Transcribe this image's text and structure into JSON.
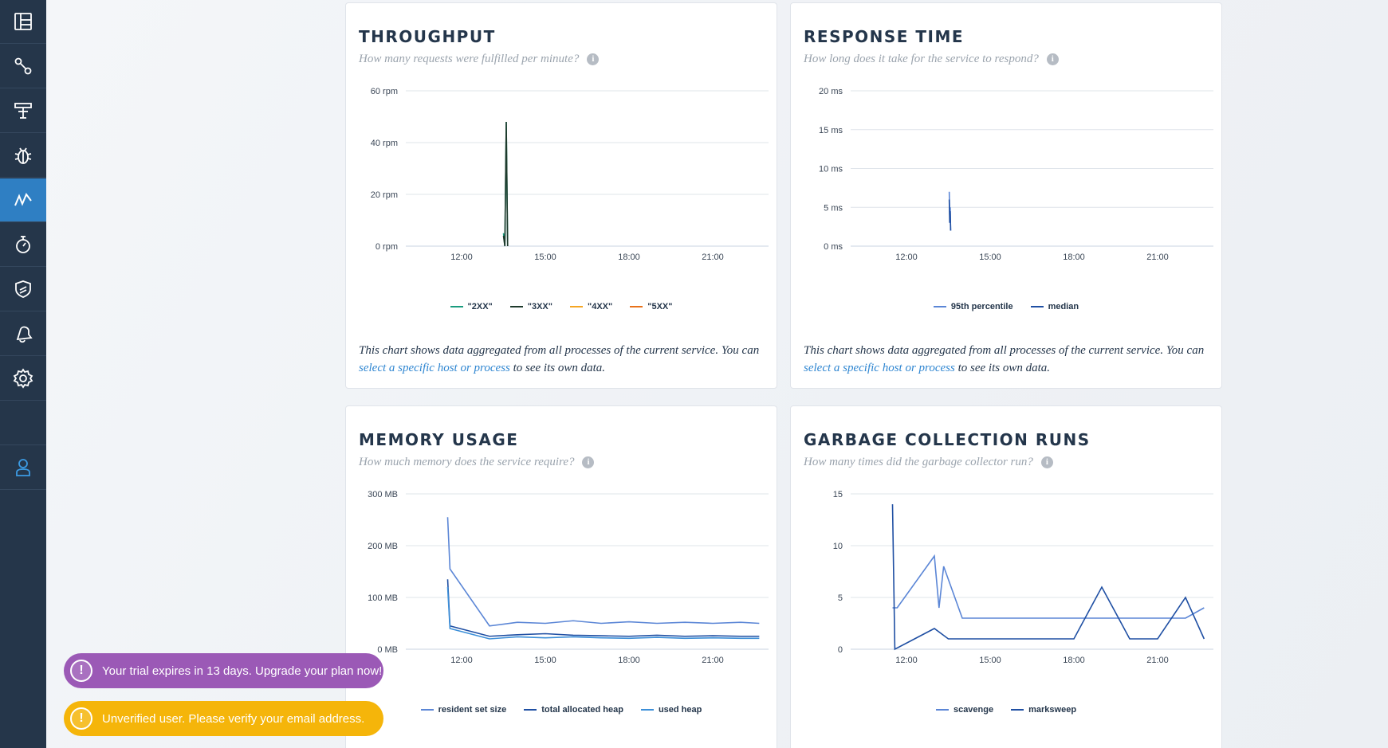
{
  "sidebar": {
    "items": [
      {
        "icon": "dashboard-icon",
        "active": false
      },
      {
        "icon": "nodes-icon",
        "active": false
      },
      {
        "icon": "funnel-icon",
        "active": false
      },
      {
        "icon": "bug-icon",
        "active": false
      },
      {
        "icon": "metrics-icon",
        "active": true
      },
      {
        "icon": "stopwatch-icon",
        "active": false
      },
      {
        "icon": "shield-icon",
        "active": false
      },
      {
        "icon": "bell-icon",
        "active": false
      },
      {
        "icon": "gear-icon",
        "active": false
      },
      {
        "icon": "blank",
        "active": false
      },
      {
        "icon": "user-icon",
        "active": false
      }
    ]
  },
  "accent": "#2f7fc3",
  "throughput": {
    "title": "THROUGHPUT",
    "subtitle": "How many requests were fulfilled per minute?",
    "note_before": "This chart shows data aggregated from all processes of the current service. You can ",
    "note_link": "select a specific host or process",
    "note_after": " to see its own data."
  },
  "response": {
    "title": "RESPONSE TIME",
    "subtitle": "How long does it take for the service to respond?",
    "note_before": "This chart shows data aggregated from all processes of the current service. You can ",
    "note_link": "select a specific host or process",
    "note_after": " to see its own data."
  },
  "memory": {
    "title": "MEMORY USAGE",
    "subtitle": "How much memory does the service require?"
  },
  "gc": {
    "title": "GARBAGE COLLECTION RUNS",
    "subtitle": "How many times did the garbage collector run?"
  },
  "toasts": {
    "trial": "Your trial expires in 13 days. Upgrade your plan now!",
    "verify": "Unverified user. Please verify your email address.",
    "trial_color": "#9b59b6",
    "verify_color": "#f5b50a"
  },
  "chart_data": [
    {
      "type": "line",
      "title": "THROUGHPUT",
      "xlim": [
        "10:00",
        "23:00"
      ],
      "x_ticks": [
        "12:00",
        "15:00",
        "18:00",
        "21:00"
      ],
      "y_ticks": [
        "0 rpm",
        "20 rpm",
        "40 rpm",
        "60 rpm"
      ],
      "ylim": [
        0,
        60
      ],
      "grid": true,
      "legend": "bottom",
      "series": [
        {
          "name": "\"2XX\"",
          "color": "#1a9c7e",
          "x": [
            "13:30",
            "13:33",
            "13:36",
            "13:39"
          ],
          "values": [
            5,
            0,
            48,
            0
          ]
        },
        {
          "name": "\"3XX\"",
          "color": "#1e3a2c",
          "x": [
            "13:30",
            "13:33",
            "13:36",
            "13:39"
          ],
          "values": [
            4,
            0,
            48,
            0
          ]
        },
        {
          "name": "\"4XX\"",
          "color": "#f5a623",
          "x": [],
          "values": []
        },
        {
          "name": "\"5XX\"",
          "color": "#e8711a",
          "x": [],
          "values": []
        }
      ]
    },
    {
      "type": "line",
      "title": "RESPONSE TIME",
      "xlim": [
        "10:00",
        "23:00"
      ],
      "x_ticks": [
        "12:00",
        "15:00",
        "18:00",
        "21:00"
      ],
      "y_ticks": [
        "0 ms",
        "5 ms",
        "10 ms",
        "15 ms",
        "20 ms"
      ],
      "ylim": [
        0,
        20
      ],
      "grid": true,
      "legend": "bottom",
      "series": [
        {
          "name": "95th percentile",
          "color": "#5b86d6",
          "x": [
            "13:32",
            "13:33",
            "13:34",
            "13:35"
          ],
          "values": [
            7,
            4,
            5,
            2
          ]
        },
        {
          "name": "median",
          "color": "#1f4fa3",
          "x": [
            "13:32",
            "13:33",
            "13:34",
            "13:35"
          ],
          "values": [
            6,
            3,
            4.5,
            2
          ]
        }
      ]
    },
    {
      "type": "line",
      "title": "MEMORY USAGE",
      "xlim": [
        "10:00",
        "23:00"
      ],
      "x_ticks": [
        "12:00",
        "15:00",
        "18:00",
        "21:00"
      ],
      "y_ticks": [
        "0 MB",
        "100 MB",
        "200 MB",
        "300 MB"
      ],
      "ylim": [
        0,
        300
      ],
      "grid": true,
      "legend": "bottom",
      "series": [
        {
          "name": "resident set size",
          "color": "#5b86d6",
          "x": [
            "11:30",
            "11:35",
            "13:00",
            "14:00",
            "15:00",
            "16:00",
            "17:00",
            "18:00",
            "19:00",
            "20:00",
            "21:00",
            "22:00",
            "22:40"
          ],
          "values": [
            255,
            155,
            45,
            52,
            50,
            55,
            50,
            53,
            50,
            52,
            50,
            52,
            50
          ]
        },
        {
          "name": "total allocated heap",
          "color": "#1f4fa3",
          "x": [
            "11:30",
            "11:35",
            "13:00",
            "14:00",
            "15:00",
            "16:00",
            "17:00",
            "18:00",
            "19:00",
            "20:00",
            "21:00",
            "22:00",
            "22:40"
          ],
          "values": [
            135,
            45,
            25,
            28,
            30,
            27,
            26,
            25,
            27,
            25,
            26,
            25,
            25
          ]
        },
        {
          "name": "used heap",
          "color": "#3c8fd8",
          "x": [
            "11:30",
            "11:35",
            "13:00",
            "14:00",
            "15:00",
            "16:00",
            "17:00",
            "18:00",
            "19:00",
            "20:00",
            "21:00",
            "22:00",
            "22:40"
          ],
          "values": [
            120,
            40,
            20,
            24,
            22,
            24,
            22,
            21,
            23,
            21,
            22,
            21,
            21
          ]
        }
      ]
    },
    {
      "type": "line",
      "title": "GARBAGE COLLECTION RUNS",
      "xlim": [
        "10:00",
        "23:00"
      ],
      "x_ticks": [
        "12:00",
        "15:00",
        "18:00",
        "21:00"
      ],
      "y_ticks": [
        "0",
        "5",
        "10",
        "15"
      ],
      "ylim": [
        0,
        15
      ],
      "grid": true,
      "legend": "bottom",
      "series": [
        {
          "name": "scavenge",
          "color": "#5b86d6",
          "x": [
            "11:30",
            "11:40",
            "13:00",
            "13:10",
            "13:20",
            "14:00",
            "15:00",
            "16:00",
            "17:00",
            "18:00",
            "19:00",
            "20:00",
            "21:00",
            "22:00",
            "22:40"
          ],
          "values": [
            4,
            4,
            9,
            4,
            8,
            3,
            3,
            3,
            3,
            3,
            3,
            3,
            3,
            3,
            4
          ]
        },
        {
          "name": "marksweep",
          "color": "#1f4fa3",
          "x": [
            "11:30",
            "11:35",
            "13:00",
            "13:30",
            "14:00",
            "15:00",
            "16:00",
            "17:00",
            "18:00",
            "19:00",
            "20:00",
            "21:00",
            "22:00",
            "22:40"
          ],
          "values": [
            14,
            0,
            2,
            1,
            1,
            1,
            1,
            1,
            1,
            6,
            1,
            1,
            5,
            1
          ]
        }
      ]
    }
  ]
}
